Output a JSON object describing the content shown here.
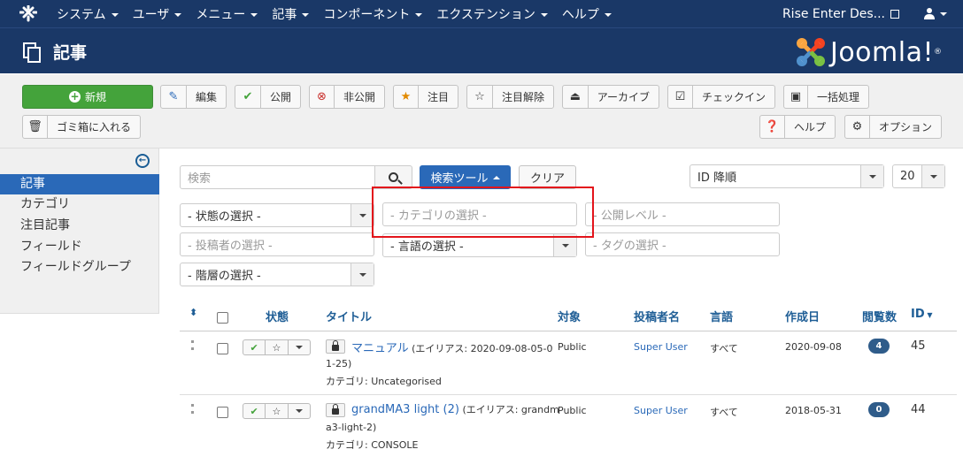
{
  "navbar": {
    "menu": [
      "システム",
      "ユーザ",
      "メニュー",
      "記事",
      "コンポーネント",
      "エクステンション",
      "ヘルプ"
    ],
    "site_name": "Rise Enter Des..."
  },
  "header": {
    "title": "記事",
    "brand": "Joomla!",
    "brand_mark": "®"
  },
  "toolbar": {
    "new": "新規",
    "edit": "編集",
    "publish": "公開",
    "unpublish": "非公開",
    "feature": "注目",
    "unfeature": "注目解除",
    "archive": "アーカイブ",
    "checkin": "チェックイン",
    "batch": "一括処理",
    "trash": "ゴミ箱に入れる",
    "help": "ヘルプ",
    "options": "オプション"
  },
  "sidebar": {
    "items": [
      "記事",
      "カテゴリ",
      "注目記事",
      "フィールド",
      "フィールドグループ"
    ],
    "active_index": 0
  },
  "filters": {
    "search_placeholder": "検索",
    "search_tools": "検索ツール",
    "clear": "クリア",
    "ordering": "ID 降順",
    "limit": "20",
    "status": "- 状態の選択 -",
    "category": "- カテゴリの選択 -",
    "access": "- 公開レベル -",
    "author": "- 投稿者の選択 -",
    "language": "- 言語の選択 -",
    "tag": "- タグの選択 -",
    "level": "- 階層の選択 -"
  },
  "table": {
    "headers": {
      "status": "状態",
      "title": "タイトル",
      "access": "対象",
      "author": "投稿者名",
      "language": "言語",
      "created": "作成日",
      "hits": "閲覧数",
      "id": "ID"
    },
    "rows": [
      {
        "title": "マニュアル",
        "alias_line1": "(エイリアス: 2020-09-08-05-0",
        "alias_line2": "1-25)",
        "category": "カテゴリ: Uncategorised",
        "access": "Public",
        "author": "Super User",
        "language": "すべて",
        "created": "2020-09-08",
        "hits": "4",
        "id": "45"
      },
      {
        "title": "grandMA3 light (2)",
        "alias_line1": "(エイリアス: grandm",
        "alias_line2": "a3-light-2)",
        "category": "カテゴリ: CONSOLE",
        "access": "Public",
        "author": "Super User",
        "language": "すべて",
        "created": "2018-05-31",
        "hits": "0",
        "id": "44"
      }
    ]
  },
  "colors": {
    "navbar": "#1a3867",
    "accent": "#2a69b8",
    "new_button": "#44a33b",
    "highlight": "#e3141b"
  }
}
